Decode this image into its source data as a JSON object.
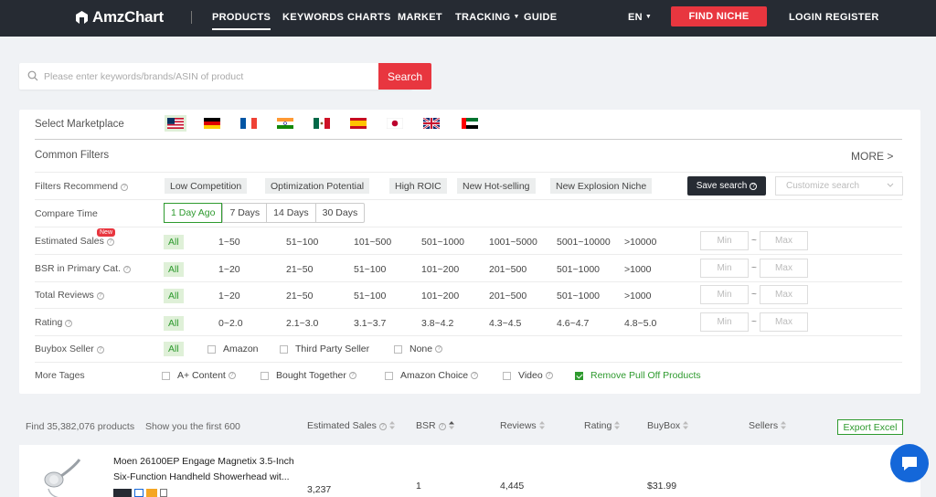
{
  "nav": {
    "logo": "AmzChart",
    "items": [
      {
        "label": "PRODUCTS",
        "active": true
      },
      {
        "label": "KEYWORDS"
      },
      {
        "label": "CHARTS"
      },
      {
        "label": "MARKET"
      },
      {
        "label": "TRACKING"
      },
      {
        "label": "GUIDE"
      }
    ],
    "language": "EN",
    "find_niche": "FIND NICHE",
    "login": "LOGIN",
    "register": "REGISTER"
  },
  "search": {
    "placeholder": "Please enter keywords/brands/ASIN of product",
    "button": "Search"
  },
  "filters": {
    "marketplace_label": "Select Marketplace",
    "marketplaces": [
      "us-flag-icon",
      "de-flag-icon",
      "fr-flag-icon",
      "in-flag-icon",
      "mx-flag-icon",
      "es-flag-icon",
      "jp-flag-icon",
      "uk-flag-icon",
      "ae-flag-icon"
    ],
    "common_filters_label": "Common Filters",
    "more": "MORE >",
    "recommend_label": "Filters Recommend",
    "recommend_chips": [
      "Low Competition",
      "Optimization Potential",
      "High ROIC",
      "New Hot-selling",
      "New Explosion Niche"
    ],
    "save_search": "Save search",
    "customize_placeholder": "Customize search",
    "compare_label": "Compare Time",
    "compare_options": [
      "1 Day Ago",
      "7 Days",
      "14 Days",
      "30 Days"
    ],
    "sales_label": "Estimated Sales",
    "new_badge": "New",
    "sales_options": [
      "All",
      "1~50",
      "51~100",
      "101~500",
      "501~1000",
      "1001~5000",
      "5001~10000",
      ">10000"
    ],
    "bsr_label": "BSR in Primary Cat.",
    "bsr_options": [
      "All",
      "1~20",
      "21~50",
      "51~100",
      "101~200",
      "201~500",
      "501~1000",
      ">1000"
    ],
    "reviews_label": "Total Reviews",
    "reviews_options": [
      "All",
      "1~20",
      "21~50",
      "51~100",
      "101~200",
      "201~500",
      "501~1000",
      ">1000"
    ],
    "rating_label": "Rating",
    "rating_options": [
      "All",
      "0~2.0",
      "2.1~3.0",
      "3.1~3.7",
      "3.8~4.2",
      "4.3~4.5",
      "4.6~4.7",
      "4.8~5.0"
    ],
    "min_placeholder": "Min",
    "max_placeholder": "Max",
    "tilde": "~",
    "buybox_label": "Buybox Seller",
    "buybox_all": "All",
    "buybox_options": [
      "Amazon",
      "Third Party Seller",
      "None"
    ],
    "tags_label": "More Tages",
    "tags_options": [
      "A+ Content",
      "Bought Together",
      "Amazon Choice",
      "Video",
      "Remove Pull Off Products"
    ]
  },
  "results": {
    "found": "Find 35,382,076 products",
    "showing": "Show you the first 600",
    "columns": [
      "Estimated Sales",
      "BSR",
      "Reviews",
      "Rating",
      "BuyBox",
      "Sellers"
    ],
    "export": "Export Excel",
    "products": [
      {
        "title": "Moen 26100EP Engage Magnetix 3.5-Inch Six-Function Handheld Showerhead wit...",
        "sales": "3,237",
        "bsr": "1",
        "reviews": "4,445",
        "buybox": "$31.99"
      }
    ]
  },
  "colors": {
    "accent": "#e8363f",
    "nav_bg": "#262b33",
    "green": "#2e9a2e",
    "chat": "#1467d9"
  }
}
